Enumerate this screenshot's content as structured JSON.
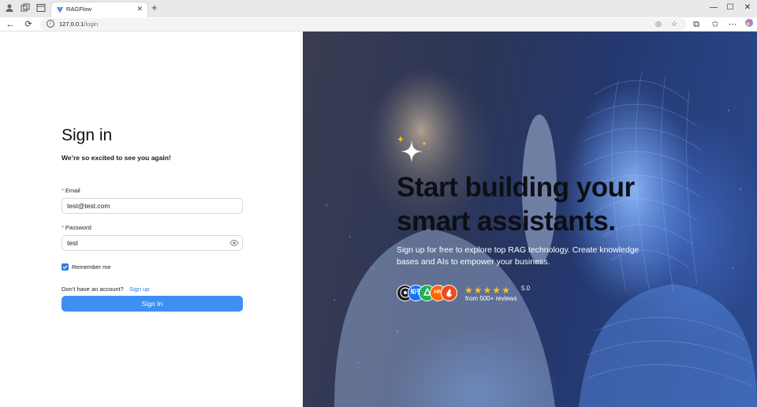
{
  "browser": {
    "tab_title": "RAGFlow",
    "url_host": "127.0.0.1",
    "url_path": "/login"
  },
  "login": {
    "title": "Sign in",
    "subtitle": "We’re so excited to see you again!",
    "email_label": "Email",
    "email_value": "test@test.com",
    "password_label": "Password",
    "password_value": "test",
    "remember_label": "Remember me",
    "remember_checked": true,
    "no_account_text": "Don’t have an account?",
    "signup_link": "Sign up",
    "signin_button": "Sign In"
  },
  "hero": {
    "title": "Start building your smart assistants.",
    "subtitle": "Sign up for free to explore top RAG technology. Create knowledge bases and AIs to empower your business.",
    "rating_value": "5.0",
    "rating_count_text": "from 500+ reviews",
    "star_count": 5,
    "avatar_labels": [
      "",
      "知乎",
      "",
      "HN",
      ""
    ]
  },
  "colors": {
    "accent": "#3d8ff4",
    "link": "#2f7de1",
    "star": "#f5c518"
  }
}
